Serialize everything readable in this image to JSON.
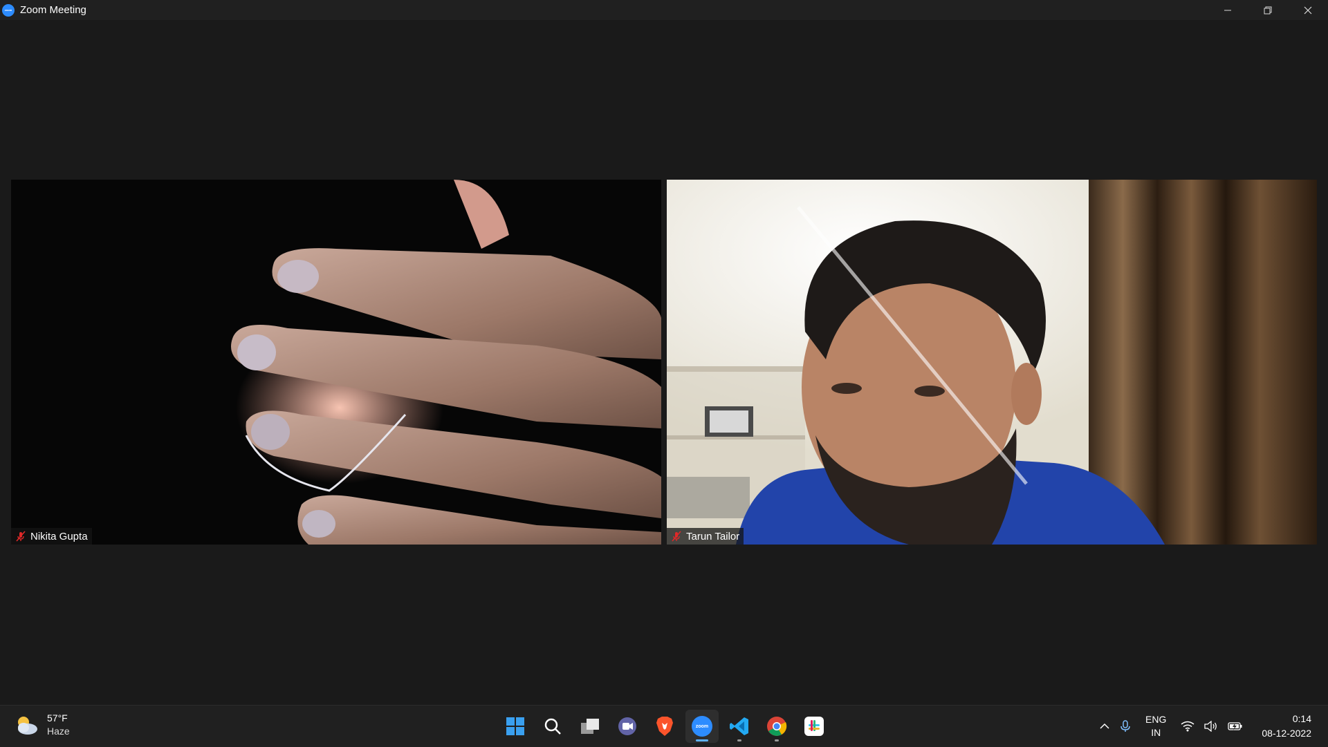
{
  "window": {
    "title": "Zoom Meeting",
    "app_icon_text": "zoom",
    "controls": {
      "minimize": "minimize",
      "restore": "restore",
      "close": "close"
    }
  },
  "participants": [
    {
      "name": "Nikita Gupta",
      "audio": "muted"
    },
    {
      "name": "Tarun Tailor",
      "audio": "muted"
    }
  ],
  "taskbar": {
    "weather": {
      "temp": "57°F",
      "condition": "Haze",
      "icon": "partly-cloudy-icon"
    },
    "apps": [
      {
        "name": "start",
        "icon": "windows-start-icon"
      },
      {
        "name": "search",
        "icon": "search-icon"
      },
      {
        "name": "task-view",
        "icon": "task-view-icon"
      },
      {
        "name": "teams-chat",
        "icon": "video-chat-icon"
      },
      {
        "name": "brave",
        "icon": "brave-icon"
      },
      {
        "name": "zoom",
        "icon": "zoom-icon",
        "active": true,
        "label": "zoom"
      },
      {
        "name": "vscode",
        "icon": "vscode-icon",
        "running": true
      },
      {
        "name": "chrome",
        "icon": "chrome-icon",
        "running": true
      },
      {
        "name": "slack",
        "icon": "slack-icon"
      }
    ],
    "tray": {
      "language_top": "ENG",
      "language_bottom": "IN",
      "time": "0:14",
      "date": "08-12-2022"
    }
  },
  "colors": {
    "stage_bg": "#1a1a1a",
    "titlebar_bg": "#202020",
    "taskbar_bg": "#202020",
    "accent": "#2d8cff",
    "mute_red": "#e02828"
  }
}
